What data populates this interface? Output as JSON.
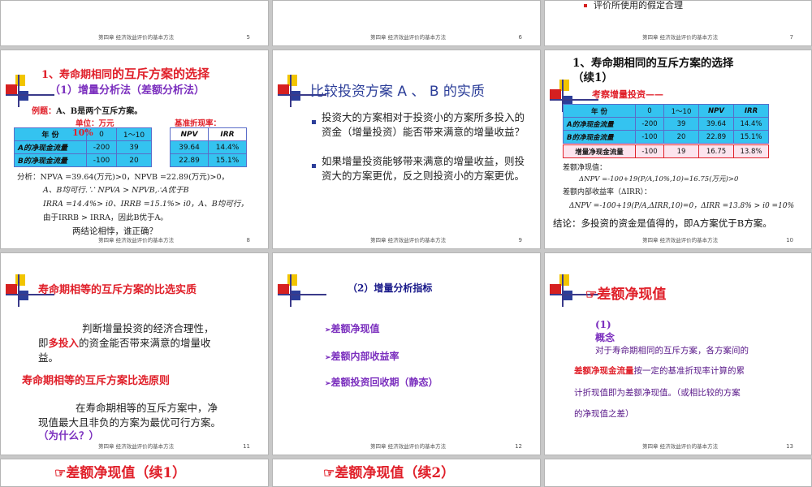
{
  "footer_chapter": "第四章 经济效益评价的基本方法",
  "row1": {
    "s5": {
      "num": "5"
    },
    "s6": {
      "num": "6"
    },
    "s7": {
      "num": "7",
      "bullet": "评价所使用的假定合理"
    }
  },
  "s8": {
    "num": "8",
    "title_part1": "1、寿命期相同",
    "title_part2": "的互斥方案的选择",
    "subtitle": "（1）增量分析法（差额分析法）",
    "example_label": "例题：",
    "example_text": "A、B是两个互斥方案。",
    "unit": "单位：万元",
    "rate_label": "基准折现率：",
    "rate_value": "10%",
    "table_head": [
      "年 份",
      "0",
      "1～10"
    ],
    "rows": [
      {
        "label": "A的净现金流量",
        "v0": "-200",
        "v1": "39"
      },
      {
        "label": "B的净现金流量",
        "v0": "-100",
        "v1": "20"
      }
    ],
    "npv_head": [
      "NPV",
      "IRR"
    ],
    "npv_rows": [
      [
        "39.64",
        "14.4%"
      ],
      [
        "22.89",
        "15.1%"
      ]
    ],
    "analysis": [
      "分析：NPVA =39.64(万元)>0，NPVB =22.89(万元)>0，",
      "A、B均可行.∵ NPVA > NPVB,∴A优于B",
      "IRRA =14.4%> i0、IRRB =15.1%> i0，A、B均可行，",
      "由于IRRB > IRRA，因此B优于A。"
    ],
    "conclusion": "两结论相悖，谁正确？"
  },
  "s9": {
    "num": "9",
    "title": "比较投资方案 A 、 B 的实质",
    "bullets": [
      "投资大的方案相对于投资小的方案所多投入的资金（增量投资）能否带来满意的增量收益？",
      "如果增量投资能够带来满意的增量收益，则投资大的方案更优，反之则投资小的方案更优。"
    ]
  },
  "s10": {
    "num": "10",
    "title_line1": "1、寿命期相同的互斥方案的选择",
    "title_line2": "（续1）",
    "subtitle": "考察增量投资——",
    "table_head": [
      "年 份",
      "0",
      "1～10",
      "NPV",
      "IRR"
    ],
    "rows": [
      [
        "A的净现金流量",
        "-200",
        "39",
        "39.64",
        "14.4%"
      ],
      [
        "B的净现金流量",
        "-100",
        "20",
        "22.89",
        "15.1%"
      ]
    ],
    "incr_row": [
      "增量净现金流量",
      "-100",
      "19",
      "16.75",
      "13.8%"
    ],
    "npv_label": "差额净现值：",
    "npv_formula": "ΔNPV =-100+19(P/A,10%,10)=16.75(万元)>0",
    "irr_label": "差额内部收益率（ΔIRR）：",
    "irr_formula": "ΔNPV =-100+19(P/A,ΔIRR,10)=0，ΔIRR =13.8% > i0 =10%",
    "conclusion": "结论：多投资的资金是值得的，即A方案优于B方案。"
  },
  "s11": {
    "num": "11",
    "title": "寿命期相等的互斥方案的比选实质",
    "para1_a": "判断增量投资的经济合理性，",
    "para1_b1": "即",
    "para1_red": "多投入",
    "para1_b2": "的资金能否带来满意的增量收",
    "para1_c": "益。",
    "principle_title": "寿命期相等的互斥方案比选原则",
    "para2_a": "在寿命期相等的互斥方案中，净",
    "para2_b": "现值最大且非负的方案为最优可行方案。",
    "para2_c": "（为什么？）"
  },
  "s12": {
    "num": "12",
    "title": "（2）增量分析指标",
    "items": [
      "差额净现值",
      "差额内部收益率",
      "差额投资回收期（静态）"
    ]
  },
  "s13": {
    "num": "13",
    "title": "差额净现值",
    "concept_label": "(1) 概念",
    "line1": "对于寿命期相同的互斥方案，各方案间的",
    "line2_red": "差额净现金流量",
    "line2_rest": "按一定的基准折现率计算的累",
    "line3": "计折现值即为差额净现值。（或相比较的方案",
    "line4": "的净现值之差）"
  },
  "row4": {
    "s14_title": "差额净现值（续1）",
    "s15_title": "差额净现值（续2）"
  }
}
